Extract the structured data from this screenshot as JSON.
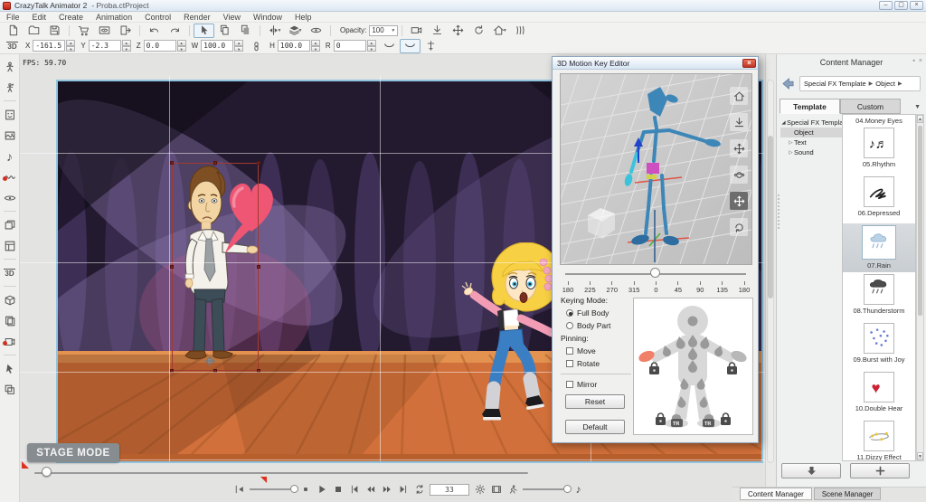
{
  "titlebar": {
    "title": "CrazyTalk Animator 2",
    "project": "- Proba.ctProject",
    "window_buttons": [
      {
        "name": "minimize",
        "glyph": "–"
      },
      {
        "name": "maximize",
        "glyph": "▢"
      },
      {
        "name": "close",
        "glyph": "×"
      }
    ]
  },
  "menu": [
    "File",
    "Edit",
    "Create",
    "Animation",
    "Control",
    "Render",
    "View",
    "Window",
    "Help"
  ],
  "toolbar": {
    "opacity_label": "Opacity:",
    "opacity_value": "100",
    "row1_groups": [
      [
        "new-file",
        "open-folder",
        "save"
      ],
      [
        "cart",
        "stage-preview",
        "export"
      ],
      [
        "undo",
        "redo"
      ],
      [
        "select-cursor",
        "copy",
        "paste-stack"
      ],
      [
        "mirror",
        "layers",
        "visibility"
      ],
      [
        "opacity-control"
      ],
      [
        "camera",
        "anchor-down",
        "move",
        "rotate",
        "home",
        "curtain"
      ]
    ],
    "row1_with_dropdown": [
      "mirror",
      "layers",
      "home"
    ],
    "row1_active": "select-cursor"
  },
  "transform": {
    "fields": [
      {
        "label": "X",
        "value": "-161.5"
      },
      {
        "label": "Y",
        "value": "-2.3"
      },
      {
        "label": "Z",
        "value": "0.0"
      },
      {
        "label": "W",
        "value": "100.0"
      },
      {
        "label": "H",
        "value": "100.0"
      },
      {
        "label": "R",
        "value": "0"
      }
    ],
    "link_after_index": 3,
    "trailing_icons": [
      "curve",
      "curve-boxed",
      "pivot-transform"
    ]
  },
  "sidebar": {
    "icons": [
      "actor",
      "motion",
      "face",
      "image",
      "music",
      "audio-record",
      "fx-eye",
      "scene-windows",
      "composer",
      "view-3d",
      "prop",
      "render-stack",
      "render-video",
      "pick-tool",
      "duplicate"
    ],
    "separators_after": [
      1,
      6,
      8,
      9,
      12
    ]
  },
  "stage": {
    "fps": "FPS: 59.70",
    "mode_badge": "STAGE MODE"
  },
  "playback": {
    "frame_value": "33",
    "buttons": [
      "jump-in",
      "speed-slider",
      "pause-small",
      "play",
      "stop",
      "skip-start",
      "rewind",
      "fast-forward",
      "skip-end",
      "loop",
      "frame-field",
      "settings",
      "render-frame",
      "motion-trail",
      "volume-slider",
      "sound"
    ]
  },
  "motion_editor": {
    "title": "3D Motion Key Editor",
    "viewport_tools": [
      "home",
      "anchor-down",
      "move",
      "orbit",
      "move-active",
      "rotate-ccw"
    ],
    "angle_ticks": [
      "180",
      "225",
      "270",
      "315",
      "0",
      "45",
      "90",
      "135",
      "180"
    ],
    "keying_mode_label": "Keying Mode:",
    "radios": [
      {
        "label": "Full Body",
        "selected": true
      },
      {
        "label": "Body Part",
        "selected": false
      }
    ],
    "pinning_label": "Pinning:",
    "checks": [
      {
        "label": "Move",
        "checked": false
      },
      {
        "label": "Rotate",
        "checked": false
      }
    ],
    "mirror_check": {
      "label": "Mirror",
      "checked": false
    },
    "reset_button": "Reset",
    "default_button": "Default",
    "foot_tag": "TR"
  },
  "content_manager": {
    "title": "Content Manager",
    "breadcrumb": [
      "Special FX Template",
      "Object"
    ],
    "tabs": [
      {
        "label": "Template",
        "active": true
      },
      {
        "label": "Custom",
        "active": false
      }
    ],
    "tree": [
      {
        "label": "Special FX Template",
        "level": 0,
        "marker": "expanded",
        "selected": false
      },
      {
        "label": "Object",
        "level": 1,
        "marker": "none",
        "selected": true
      },
      {
        "label": "Text",
        "level": 1,
        "marker": "collapsed",
        "selected": false
      },
      {
        "label": "Sound",
        "level": 1,
        "marker": "collapsed",
        "selected": false
      }
    ],
    "clipped_top_label": "04.Money Eyes",
    "items": [
      {
        "label": "05.Rhythm",
        "icon": "rhythm",
        "selected": false
      },
      {
        "label": "06.Depressed",
        "icon": "depressed",
        "selected": false
      },
      {
        "label": "07.Rain",
        "icon": "rain",
        "selected": true
      },
      {
        "label": "08.Thunderstorm",
        "icon": "thunderstorm",
        "selected": false
      },
      {
        "label": "09.Burst with Joy",
        "icon": "burst-joy",
        "selected": false
      },
      {
        "label": "10.Double Hear",
        "icon": "double-heart",
        "selected": false
      },
      {
        "label": "11.Dizzy Effect",
        "icon": "dizzy",
        "selected": false
      }
    ],
    "bottom_buttons": [
      "download",
      "add"
    ],
    "bottom_tabs": [
      {
        "label": "Content Manager",
        "active": true
      },
      {
        "label": "Scene Manager",
        "active": false
      }
    ]
  }
}
